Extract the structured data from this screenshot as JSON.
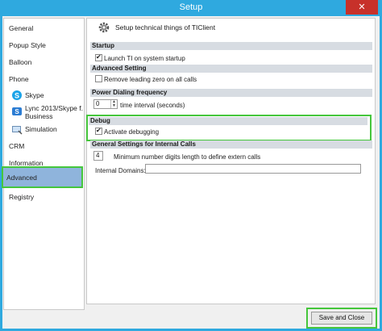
{
  "window": {
    "title": "Setup",
    "close_glyph": "✕"
  },
  "sidebar": {
    "items": [
      {
        "label": "General"
      },
      {
        "label": "Popup Style"
      },
      {
        "label": "Balloon"
      },
      {
        "label": "Phone"
      },
      {
        "label": "Skype"
      },
      {
        "label": "Lync 2013/Skype f.",
        "label2": "Business"
      },
      {
        "label": "Simulation"
      },
      {
        "label": "CRM"
      },
      {
        "label": "Information"
      },
      {
        "label": "Advanced"
      },
      {
        "label": "Registry"
      }
    ],
    "selected": "Advanced"
  },
  "panel": {
    "header": "Setup technical things of TIClient",
    "startup": {
      "title": "Startup",
      "launch_label": "Launch TI on system startup",
      "launch_checked": true
    },
    "advanced": {
      "title": "Advanced Setting",
      "remove_zero_label": "Remove leading zero on all calls",
      "remove_zero_checked": false
    },
    "power": {
      "title": "Power Dialing frequency",
      "interval_value": "0",
      "interval_label": "time interval (seconds)"
    },
    "debug": {
      "title": "Debug",
      "activate_label": "Activate debugging",
      "activate_checked": true
    },
    "internal": {
      "title": "General Settings for Internal Calls",
      "min_digits_value": "4",
      "min_digits_label": "Minimum number digits length to define extern calls",
      "domains_label": "Internal Domains:",
      "domains_value": ""
    }
  },
  "footer": {
    "save_close_label": "Save and Close"
  },
  "colors": {
    "titlebar": "#2fa9df",
    "close": "#c7312a",
    "highlight": "#45c63c",
    "selected": "#8fb4dc",
    "section": "#d7dce2"
  }
}
